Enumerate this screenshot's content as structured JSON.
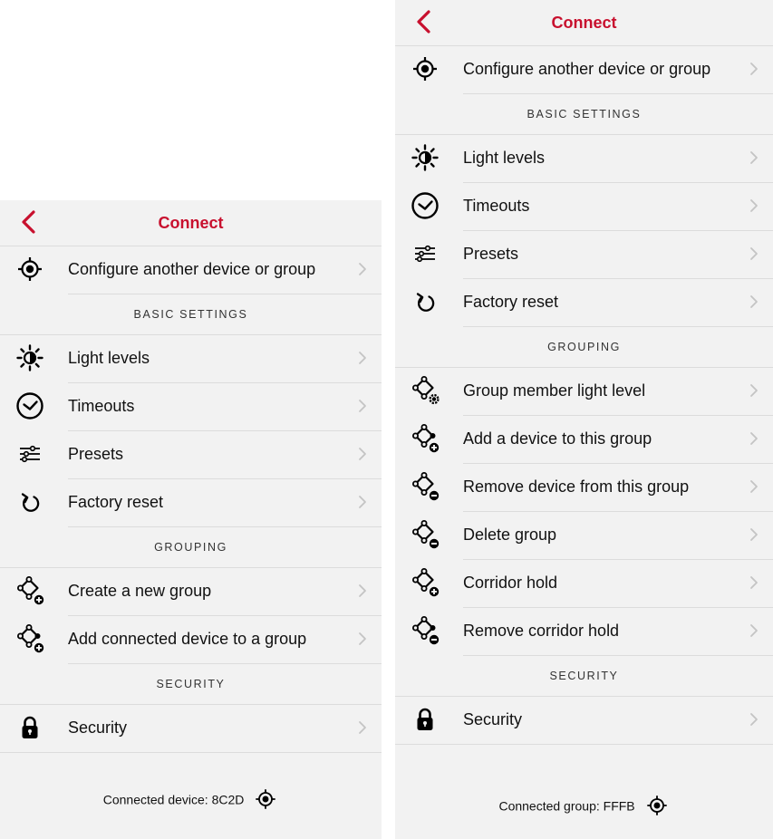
{
  "colors": {
    "accent": "#c8102e",
    "panel_bg": "#f2f2f2",
    "separator": "#dcdcdc"
  },
  "left_screen": {
    "nav": {
      "title": "Connect",
      "back_icon": "chevron-left-icon"
    },
    "top_row": {
      "label": "Configure another device or group",
      "icon": "locate-target-icon"
    },
    "sections": {
      "basic_settings": "BASIC SETTINGS",
      "grouping": "GROUPING",
      "security": "SECURITY"
    },
    "basic_items": [
      {
        "label": "Light levels",
        "icon": "light-level-icon"
      },
      {
        "label": "Timeouts",
        "icon": "clock-icon"
      },
      {
        "label": "Presets",
        "icon": "sliders-icon"
      },
      {
        "label": "Factory reset",
        "icon": "reset-icon"
      }
    ],
    "grouping_items": [
      {
        "label": "Create a new group",
        "icon": "group-add-icon"
      },
      {
        "label": "Add connected device to a group",
        "icon": "device-add-to-group-icon"
      }
    ],
    "security_items": [
      {
        "label": "Security",
        "icon": "lock-icon"
      }
    ],
    "footer": {
      "text": "Connected device: 8C2D",
      "icon": "locate-target-icon"
    }
  },
  "right_screen": {
    "nav": {
      "title": "Connect",
      "back_icon": "chevron-left-icon"
    },
    "top_row": {
      "label": "Configure another device or group",
      "icon": "locate-target-icon"
    },
    "sections": {
      "basic_settings": "BASIC SETTINGS",
      "grouping": "GROUPING",
      "security": "SECURITY"
    },
    "basic_items": [
      {
        "label": "Light levels",
        "icon": "light-level-icon"
      },
      {
        "label": "Timeouts",
        "icon": "clock-icon"
      },
      {
        "label": "Presets",
        "icon": "sliders-icon"
      },
      {
        "label": "Factory reset",
        "icon": "reset-icon"
      }
    ],
    "grouping_items": [
      {
        "label": "Group member light level",
        "icon": "group-settings-icon"
      },
      {
        "label": "Add a device to this group",
        "icon": "device-add-to-group-icon"
      },
      {
        "label": "Remove device from this group",
        "icon": "device-remove-from-group-icon"
      },
      {
        "label": "Delete group",
        "icon": "group-delete-icon"
      },
      {
        "label": "Corridor hold",
        "icon": "corridor-hold-icon"
      },
      {
        "label": "Remove corridor hold",
        "icon": "remove-corridor-hold-icon"
      }
    ],
    "security_items": [
      {
        "label": "Security",
        "icon": "lock-icon"
      }
    ],
    "footer": {
      "text": "Connected group: FFFB",
      "icon": "locate-target-icon"
    }
  }
}
